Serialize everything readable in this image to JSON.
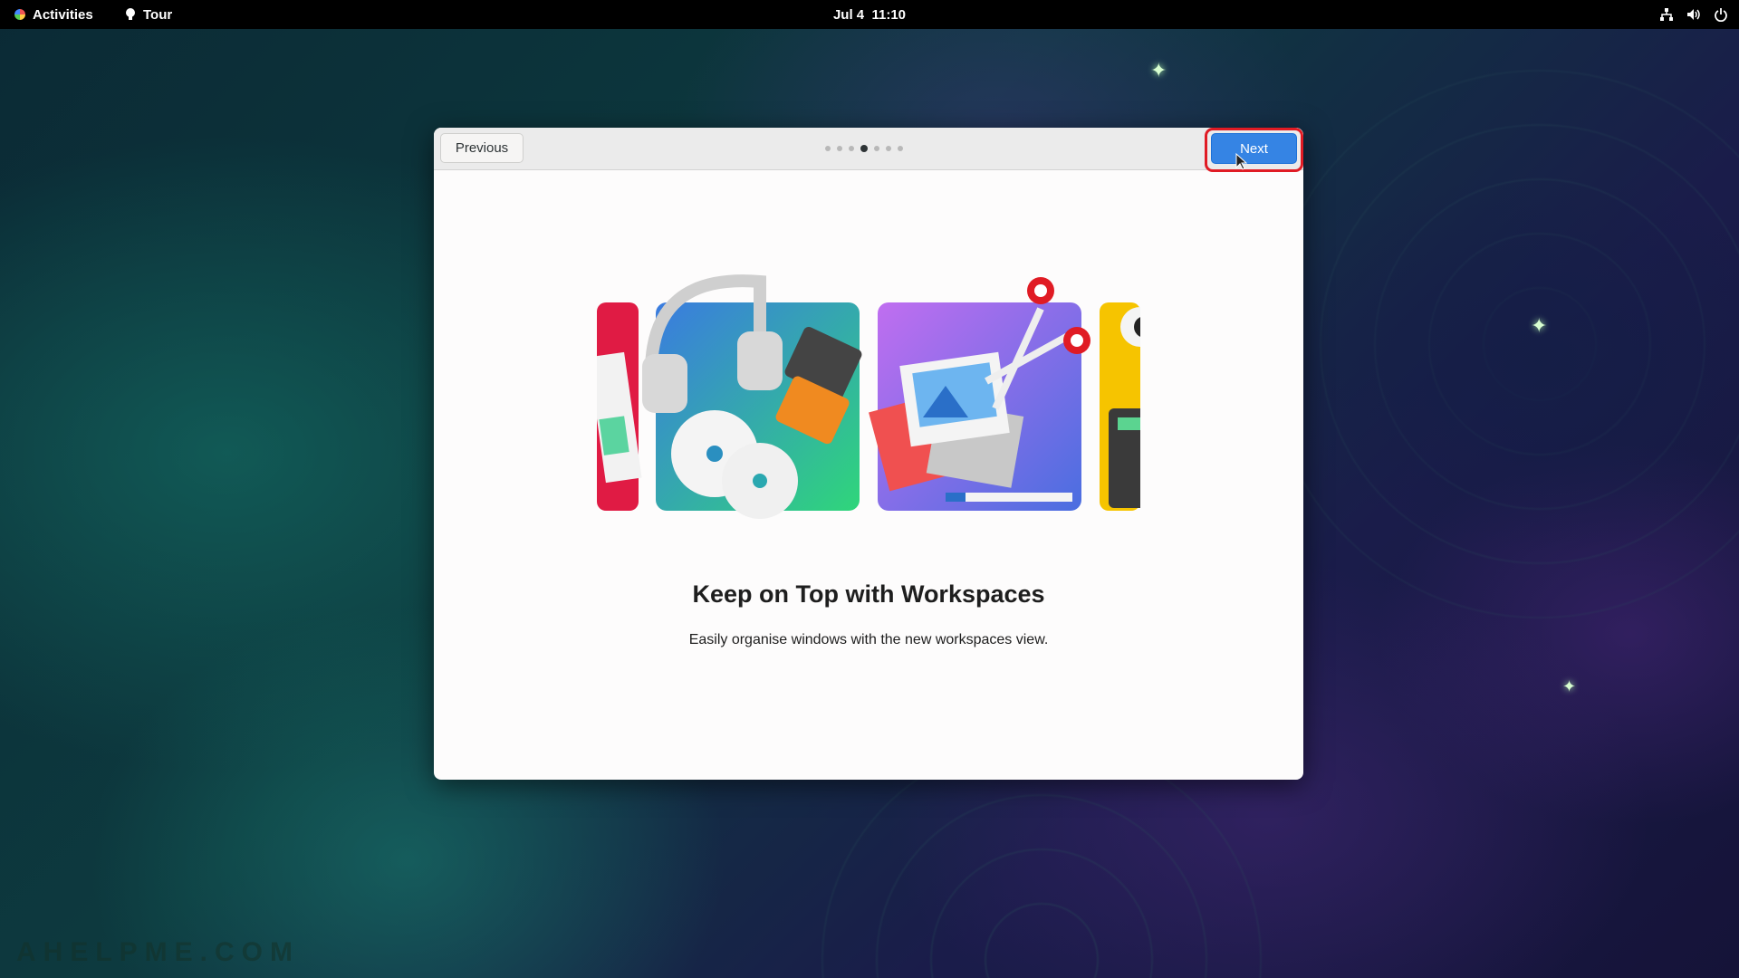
{
  "topbar": {
    "activities_label": "Activities",
    "app_label": "Tour",
    "clock": "Jul 4  11:10",
    "tray_icons": [
      "network-icon",
      "volume-icon",
      "power-icon"
    ]
  },
  "dialog": {
    "previous_label": "Previous",
    "next_label": "Next",
    "page_indicator": {
      "total": 7,
      "current": 4
    },
    "title": "Keep on Top with Workspaces",
    "subtitle": "Easily organise windows with the new workspaces view."
  },
  "colors": {
    "accent": "#3584e4",
    "highlight_ring": "#e01b24"
  },
  "watermark": "AHELPME.COM"
}
